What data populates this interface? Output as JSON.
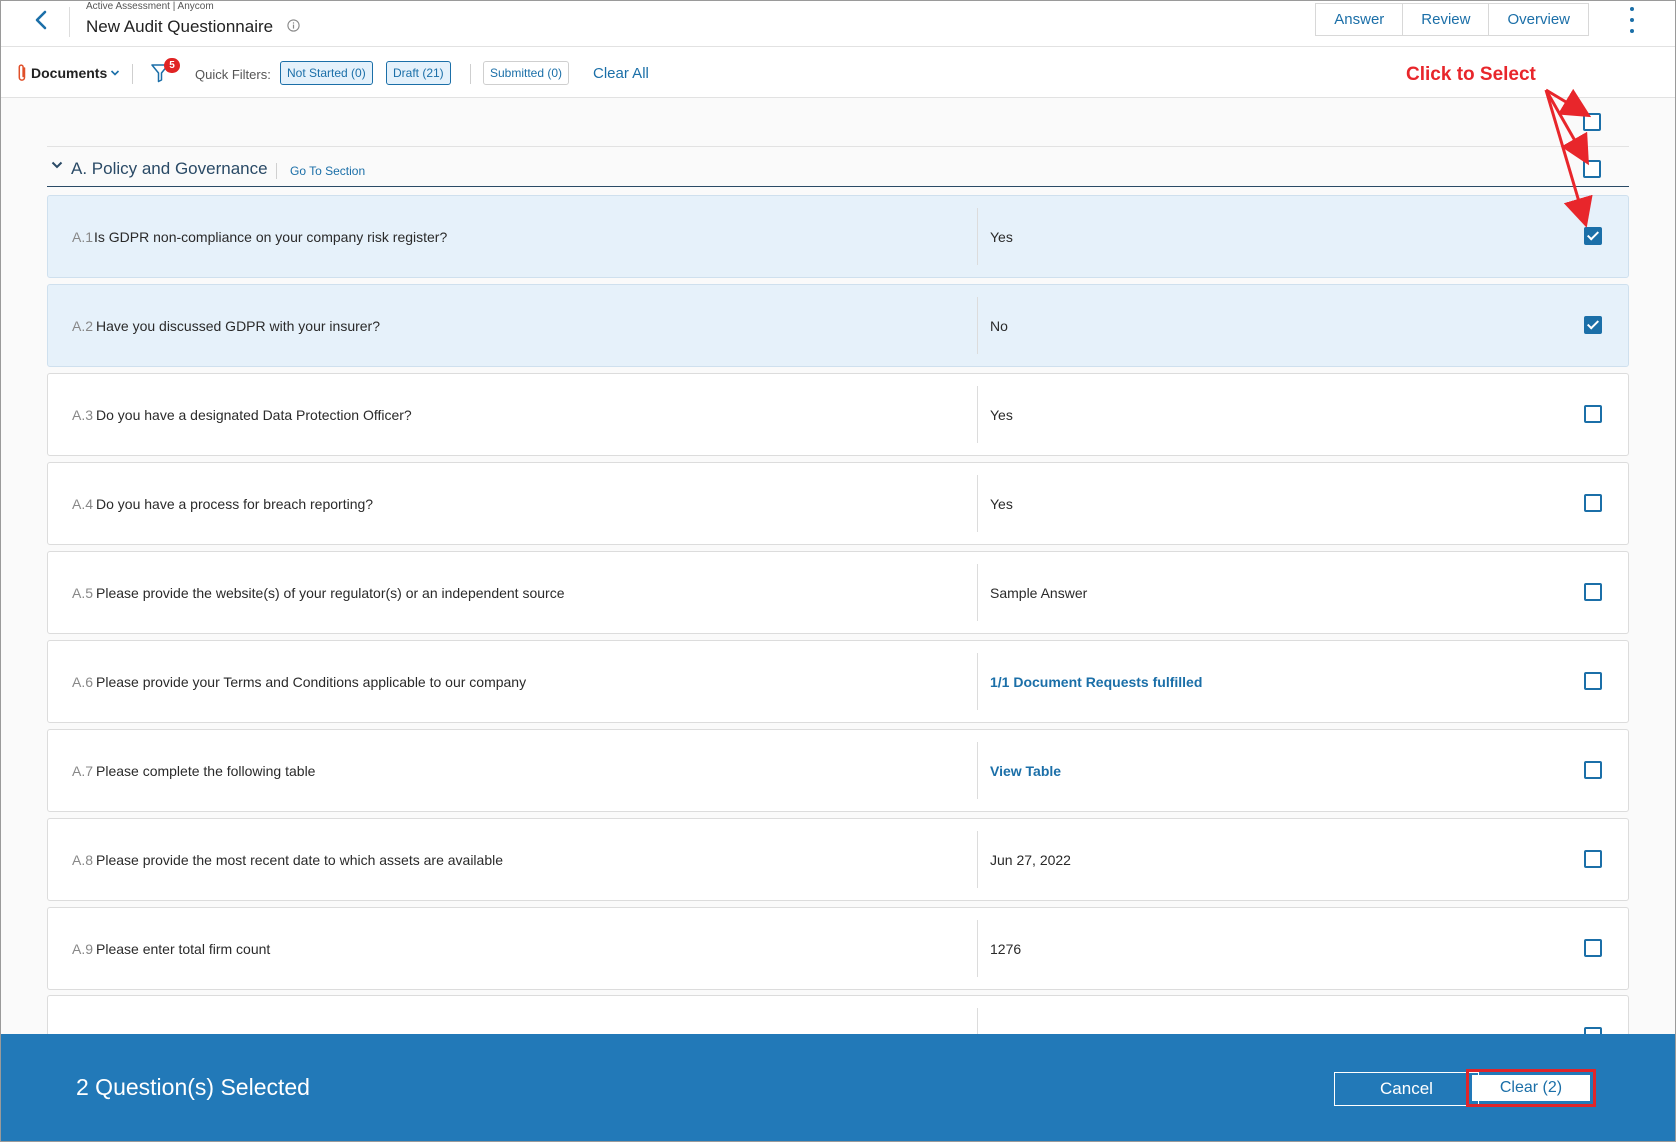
{
  "header": {
    "breadcrumb": "Active Assessment | Anycom",
    "title": "New Audit Questionnaire",
    "tabs": [
      "Answer",
      "Review",
      "Overview"
    ]
  },
  "filterbar": {
    "documents_label": "Documents",
    "filter_badge": "5",
    "quick_filters_label": "Quick Filters:",
    "chips": [
      "Not Started (0)",
      "Draft (21)",
      "Submitted (0)"
    ],
    "clear_all": "Clear All"
  },
  "section": {
    "title": "A. Policy and Governance",
    "goto": "Go To Section"
  },
  "questions": [
    {
      "num": "A.1",
      "text": "Is GDPR non-compliance on your company risk register?",
      "answer": "Yes",
      "selected": true
    },
    {
      "num": "A.2",
      "text": "Have you discussed GDPR with your insurer?",
      "answer": "No",
      "selected": true
    },
    {
      "num": "A.3",
      "text": "Do you have a designated Data Protection Officer?",
      "answer": "Yes",
      "selected": false
    },
    {
      "num": "A.4",
      "text": "Do you have a process for breach reporting?",
      "answer": "Yes",
      "selected": false
    },
    {
      "num": "A.5",
      "text": "Please provide the website(s) of your regulator(s) or an independent source",
      "answer": "Sample Answer",
      "selected": false
    },
    {
      "num": "A.6",
      "text": "Please provide your Terms and Conditions applicable to our company",
      "answer": "1/1 Document Requests fulfilled",
      "selected": false,
      "link": true
    },
    {
      "num": "A.7",
      "text": "Please complete the following table",
      "answer": "View Table",
      "selected": false,
      "link": true
    },
    {
      "num": "A.8",
      "text": "Please provide the most recent date to which assets are available",
      "answer": "Jun 27, 2022",
      "selected": false
    },
    {
      "num": "A.9",
      "text": "Please enter total firm count",
      "answer": "1276",
      "selected": false
    }
  ],
  "annotation": "Click to Select",
  "bottombar": {
    "selected_text": "2 Question(s) Selected",
    "cancel": "Cancel",
    "clear": "Clear (2)"
  },
  "colors": {
    "accent": "#1b6fa8",
    "bottom_bar": "#2279b8",
    "selected_row": "#e6f1fa",
    "annotation_red": "#e8262b"
  }
}
